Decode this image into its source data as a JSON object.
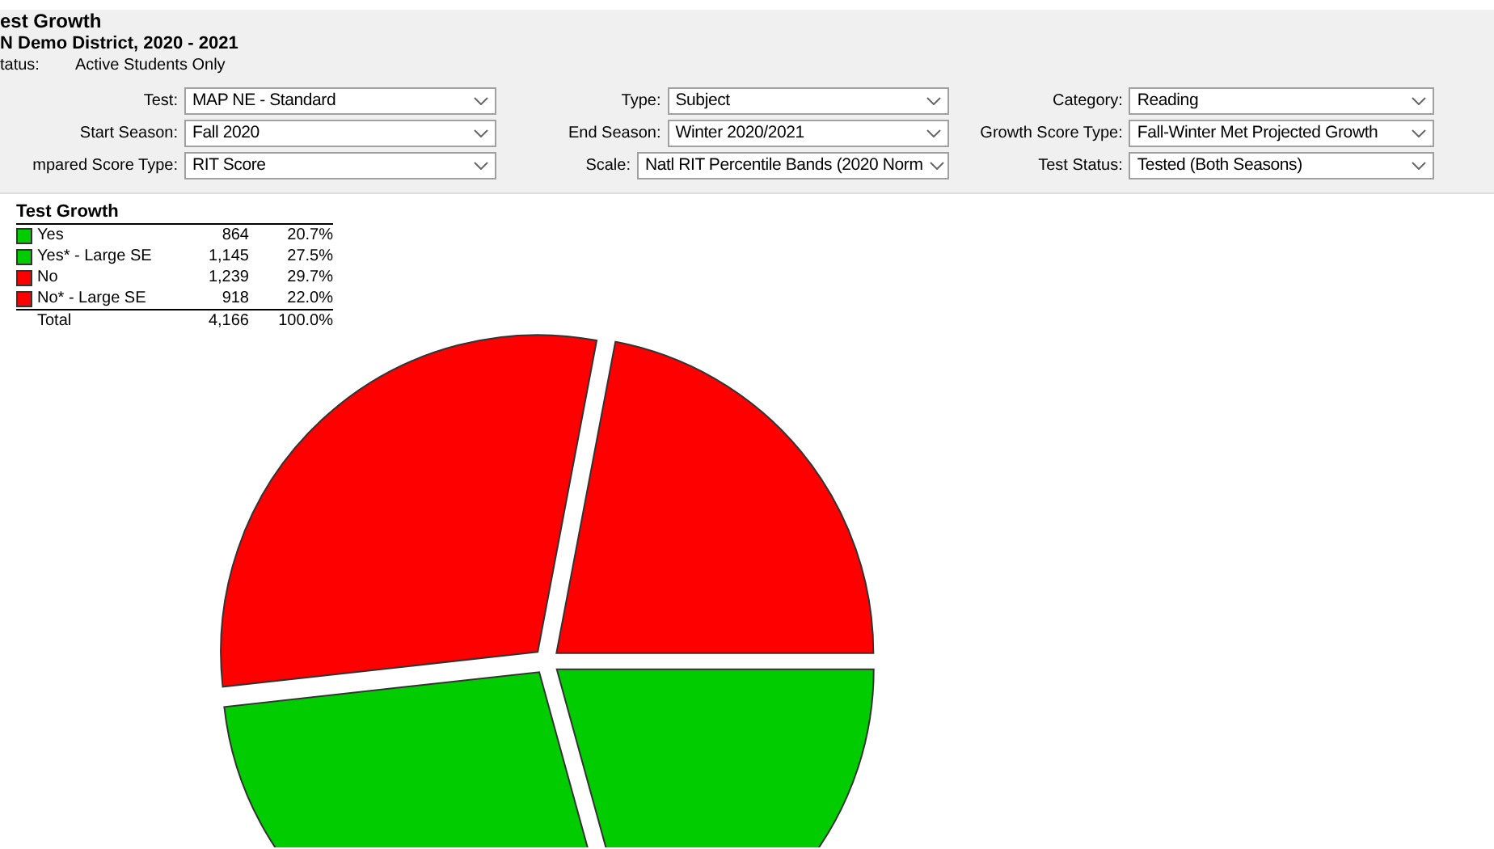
{
  "header": {
    "title": "est Growth",
    "subtitle": "N Demo District, 2020 - 2021",
    "status_label": "tatus:",
    "status_value": "Active Students Only"
  },
  "filters": [
    {
      "label": "Test:",
      "value": "MAP NE - Standard"
    },
    {
      "label": "Type:",
      "value": "Subject"
    },
    {
      "label": "Category:",
      "value": "Reading"
    },
    {
      "label": "Start Season:",
      "value": "Fall 2020"
    },
    {
      "label": "End Season:",
      "value": "Winter 2020/2021"
    },
    {
      "label": "Growth Score Type:",
      "value": "Fall-Winter Met Projected Growth"
    },
    {
      "label": "mpared Score Type:",
      "value": "RIT Score"
    },
    {
      "label": "Scale:",
      "value": "Natl RIT Percentile Bands (2020 Norm"
    },
    {
      "label": "Test Status:",
      "value": "Tested (Both Seasons)"
    }
  ],
  "legend": {
    "title": "Test Growth",
    "rows": [
      {
        "label": "Yes",
        "count": "864",
        "percent": "20.7%",
        "color": "#00cc00"
      },
      {
        "label": "Yes* - Large SE",
        "count": "1,145",
        "percent": "27.5%",
        "color": "#00cc00"
      },
      {
        "label": "No",
        "count": "1,239",
        "percent": "29.7%",
        "color": "#ff0000"
      },
      {
        "label": "No* - Large SE",
        "count": "918",
        "percent": "22.0%",
        "color": "#ff0000"
      }
    ],
    "total": {
      "label": "Total",
      "count": "4,166",
      "percent": "100.0%"
    }
  },
  "chart_data": {
    "type": "pie",
    "values": [
      20.7,
      27.5,
      29.7,
      22.0
    ]
  }
}
